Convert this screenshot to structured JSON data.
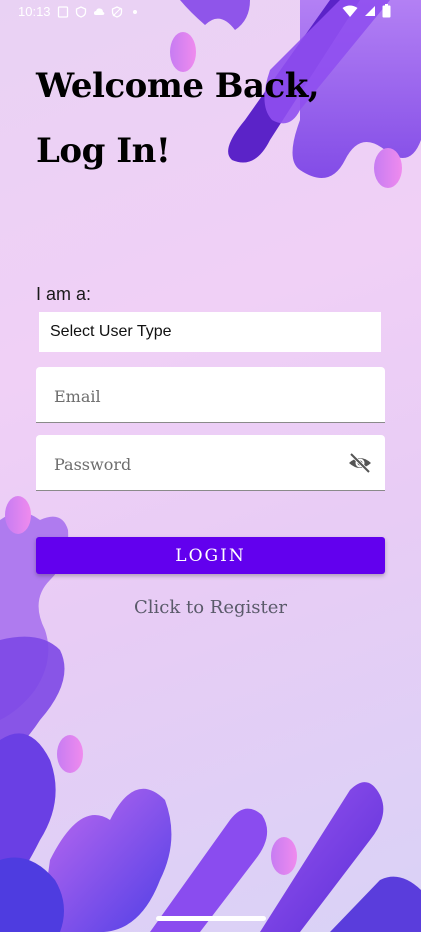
{
  "status_bar": {
    "time": "10:13",
    "left_icons": [
      "sim-icon",
      "shield-icon",
      "cloud-icon",
      "shield-icon",
      "dot-icon"
    ],
    "right_icons": [
      "wifi-icon",
      "signal-icon",
      "battery-icon"
    ]
  },
  "header": {
    "line1": "Welcome Back,",
    "line2": "Log In!"
  },
  "form": {
    "user_type_label": "I am a:",
    "user_type_select": "Select User Type",
    "email_placeholder": "Email",
    "password_placeholder": "Password",
    "password_toggle_icon": "eye-off-icon",
    "login_label": "LOGIN",
    "register_label": "Click to Register"
  },
  "colors": {
    "accent": "#6200ee",
    "background": "#f0d0f6",
    "blob_purple": "#7b3fe0",
    "blob_blue": "#4a4ae0"
  }
}
